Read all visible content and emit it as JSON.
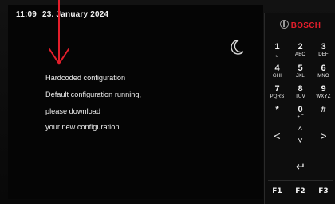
{
  "header": {
    "time": "11:09",
    "date": "23. January 2024"
  },
  "message": {
    "line1": "Hardcoded configuration",
    "line2": "Default configuration running,",
    "line3": "please download",
    "line4": "your new configuration."
  },
  "icons": {
    "night_mode": "moon-icon",
    "annotation": "arrow-down-icon",
    "enter": "enter-icon"
  },
  "colors": {
    "brand": "#e41e2b",
    "annotation_arrow": "#e41e2b",
    "background": "#000000"
  },
  "keypad": {
    "brand": "BOSCH",
    "keys": [
      {
        "digit": "1",
        "letters": "␣"
      },
      {
        "digit": "2",
        "letters": "ABC"
      },
      {
        "digit": "3",
        "letters": "DEF"
      },
      {
        "digit": "4",
        "letters": "GHI"
      },
      {
        "digit": "5",
        "letters": "JKL"
      },
      {
        "digit": "6",
        "letters": "MNO"
      },
      {
        "digit": "7",
        "letters": "PQRS"
      },
      {
        "digit": "8",
        "letters": "TUV"
      },
      {
        "digit": "9",
        "letters": "WXYZ"
      },
      {
        "digit": "*",
        "letters": ""
      },
      {
        "digit": "0",
        "letters": "+·˜"
      },
      {
        "digit": "#",
        "letters": ""
      }
    ],
    "nav": {
      "left": "<",
      "up": "^",
      "down": "˅",
      "right": ">"
    },
    "enter": "↵",
    "function_keys": [
      "F1",
      "F2",
      "F3"
    ]
  }
}
